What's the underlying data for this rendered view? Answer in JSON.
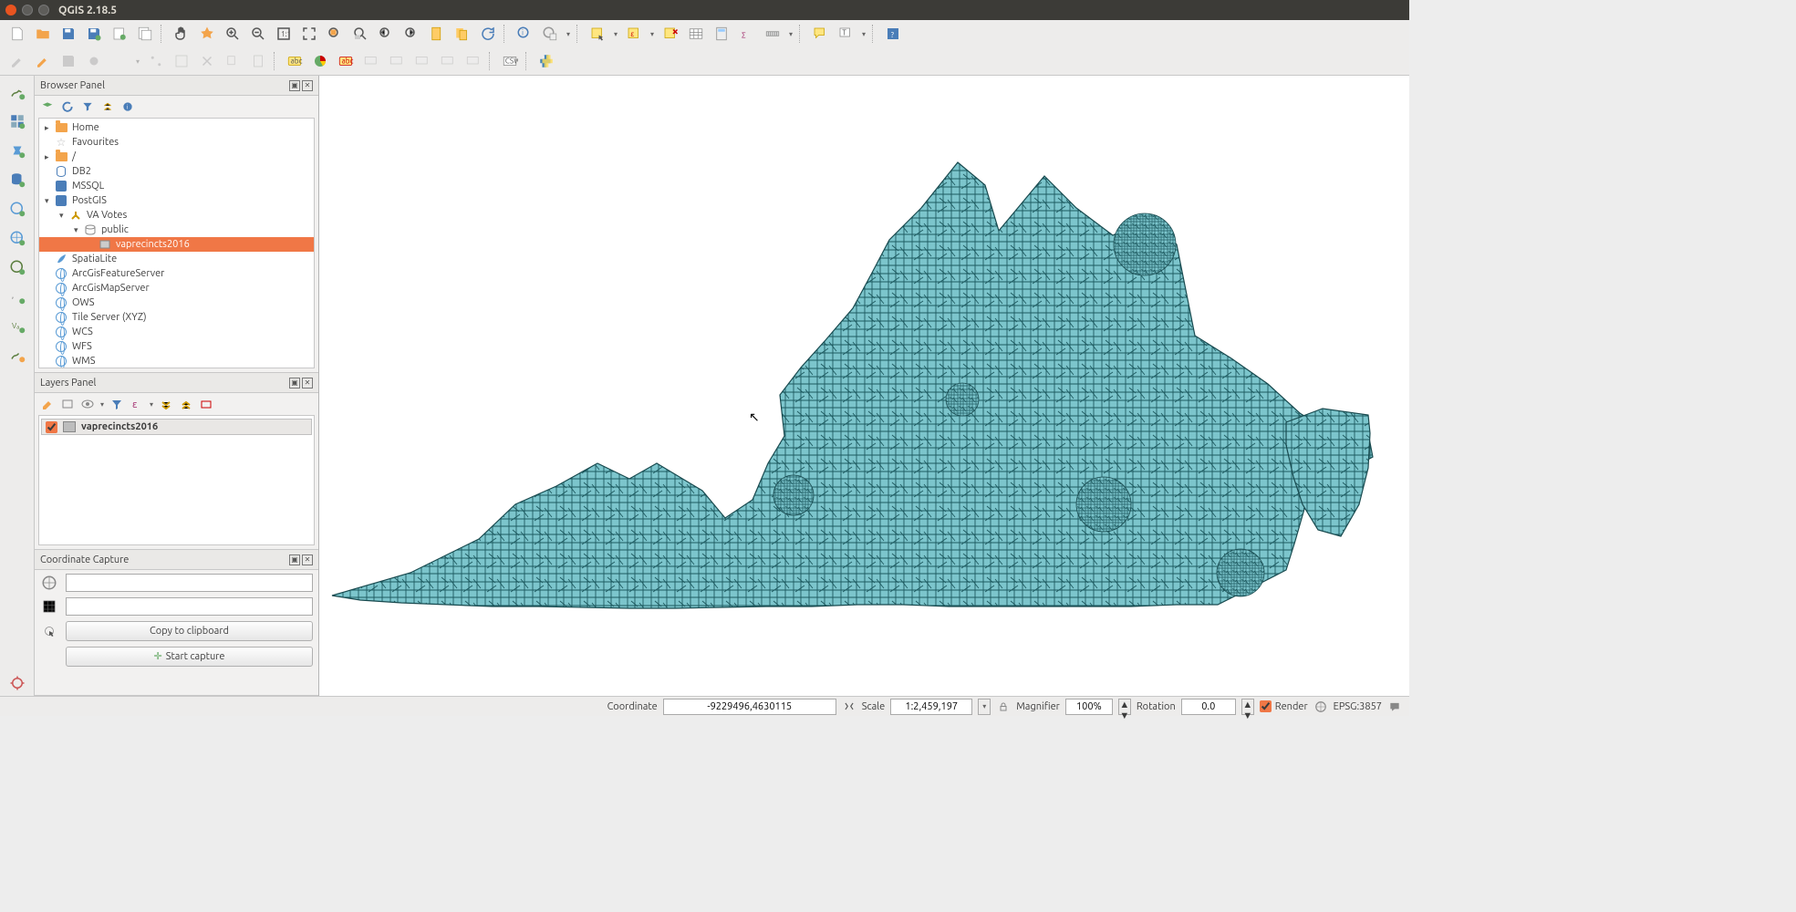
{
  "titlebar": {
    "title": "QGIS 2.18.5"
  },
  "panels": {
    "browser": {
      "title": "Browser Panel",
      "items": [
        {
          "level": 0,
          "exp": "▸",
          "ico": "folder",
          "label": "Home"
        },
        {
          "level": 0,
          "exp": "",
          "ico": "star",
          "label": "Favourites"
        },
        {
          "level": 0,
          "exp": "▸",
          "ico": "folder",
          "label": "/"
        },
        {
          "level": 0,
          "exp": "",
          "ico": "db",
          "label": "DB2"
        },
        {
          "level": 0,
          "exp": "",
          "ico": "pg",
          "label": "MSSQL"
        },
        {
          "level": 0,
          "exp": "▾",
          "ico": "pg",
          "label": "PostGIS"
        },
        {
          "level": 1,
          "exp": "▾",
          "ico": "conn",
          "label": "VA Votes"
        },
        {
          "level": 2,
          "exp": "▾",
          "ico": "schema",
          "label": "public"
        },
        {
          "level": 3,
          "exp": "",
          "ico": "table",
          "label": "vaprecincts2016",
          "selected": true
        },
        {
          "level": 0,
          "exp": "",
          "ico": "feather",
          "label": "SpatiaLite"
        },
        {
          "level": 0,
          "exp": "",
          "ico": "globe",
          "label": "ArcGisFeatureServer"
        },
        {
          "level": 0,
          "exp": "",
          "ico": "globe",
          "label": "ArcGisMapServer"
        },
        {
          "level": 0,
          "exp": "",
          "ico": "globe",
          "label": "OWS"
        },
        {
          "level": 0,
          "exp": "",
          "ico": "globe",
          "label": "Tile Server (XYZ)"
        },
        {
          "level": 0,
          "exp": "",
          "ico": "globe",
          "label": "WCS"
        },
        {
          "level": 0,
          "exp": "",
          "ico": "globe",
          "label": "WFS"
        },
        {
          "level": 0,
          "exp": "",
          "ico": "globe",
          "label": "WMS"
        }
      ]
    },
    "layers": {
      "title": "Layers Panel",
      "items": [
        {
          "checked": true,
          "label": "vaprecincts2016"
        }
      ]
    },
    "coord": {
      "title": "Coordinate Capture",
      "field1": "",
      "field2": "",
      "copy_label": "Copy to clipboard",
      "start_label": "Start capture"
    }
  },
  "statusbar": {
    "coord_label": "Coordinate",
    "coord_value": "-9229496,4630115",
    "scale_label": "Scale",
    "scale_value": "1:2,459,197",
    "mag_label": "Magnifier",
    "mag_value": "100%",
    "rot_label": "Rotation",
    "rot_value": "0.0",
    "render_label": "Render",
    "crs_label": "EPSG:3857"
  },
  "map": {
    "fill": "#7cc5cc",
    "stroke": "#184a4f",
    "layer_name": "vaprecincts2016"
  }
}
